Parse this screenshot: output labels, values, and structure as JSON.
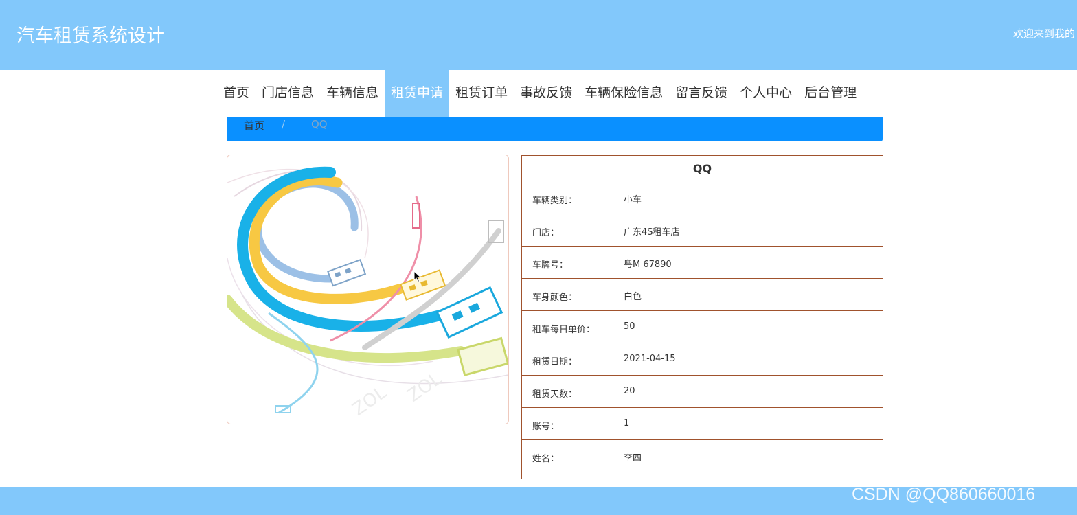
{
  "header": {
    "site_title": "汽车租赁系统设计",
    "welcome": "欢迎来到我的"
  },
  "nav": {
    "items": [
      {
        "label": "首页"
      },
      {
        "label": "门店信息"
      },
      {
        "label": "车辆信息"
      },
      {
        "label": "租赁申请",
        "active": true
      },
      {
        "label": "租赁订单"
      },
      {
        "label": "事故反馈"
      },
      {
        "label": "车辆保险信息"
      },
      {
        "label": "留言反馈"
      },
      {
        "label": "个人中心"
      },
      {
        "label": "后台管理"
      }
    ]
  },
  "breadcrumb": {
    "home": "首页",
    "separator": "/",
    "current": "QQ"
  },
  "detail": {
    "title": "QQ",
    "rows": [
      {
        "label": "车辆类别：",
        "value": "小车"
      },
      {
        "label": "门店：",
        "value": "广东4S租车店"
      },
      {
        "label": "车牌号：",
        "value": "粤M 67890"
      },
      {
        "label": "车身颜色：",
        "value": "白色"
      },
      {
        "label": "租车每日单价：",
        "value": "50"
      },
      {
        "label": "租赁日期：",
        "value": "2021-04-15"
      },
      {
        "label": "租赁天数：",
        "value": "20"
      },
      {
        "label": "账号：",
        "value": "1"
      },
      {
        "label": "姓名：",
        "value": "李四"
      }
    ]
  },
  "watermark": "CSDN @QQ860660016",
  "colors": {
    "header_bg": "#82c8fb",
    "breadcrumb_bg": "#0a90ff",
    "table_border": "#a0522d"
  },
  "icons": {
    "cursor": "mouse-pointer-icon",
    "product_image": "usb-cables-illustration"
  }
}
